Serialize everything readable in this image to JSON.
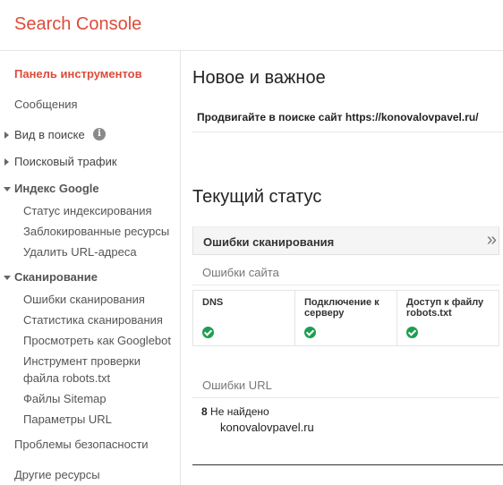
{
  "app": {
    "title": "Search Console"
  },
  "sidebar": {
    "dashboard": "Панель инструментов",
    "messages": "Сообщения",
    "search_appearance": "Вид в поиске",
    "search_traffic": "Поисковый трафик",
    "google_index": {
      "label": "Индекс Google",
      "items": [
        "Статус индексирования",
        "Заблокированные ресурсы",
        "Удалить URL-адреса"
      ]
    },
    "crawl": {
      "label": "Сканирование",
      "items": [
        "Ошибки сканирования",
        "Статистика сканирования",
        "Просмотреть как Googlebot",
        "Инструмент проверки",
        "файла robots.txt",
        "Файлы Sitemap",
        "Параметры URL"
      ]
    },
    "security": "Проблемы безопасности",
    "other": "Другие ресурсы"
  },
  "main": {
    "news_title": "Новое и важное",
    "promo": "Продвигайте в поиске сайт https://konovalovpavel.ru/",
    "status_title": "Текущий статус",
    "crawl_errors": "Ошибки сканирования",
    "site_errors": "Ошибки сайта",
    "columns": [
      {
        "line1": "DNS",
        "line2": ""
      },
      {
        "line1": "Подключение к",
        "line2": "серверу"
      },
      {
        "line1": "Доступ к файлу",
        "line2": "robots.txt"
      }
    ],
    "url_errors": "Ошибки URL",
    "url_count": "8",
    "url_not_found": "Не найдено"
  },
  "watermark": "konovalovpavel.ru",
  "colors": {
    "brand": "#dd4b39",
    "ok": "#1e9e53"
  }
}
